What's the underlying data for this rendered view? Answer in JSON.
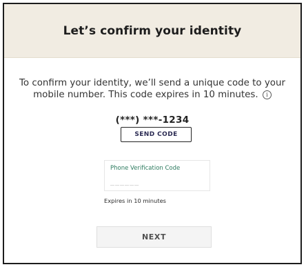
{
  "modal": {
    "title": "Let’s confirm your identity",
    "description_line1": "To confirm your identity, we’ll send a unique code to your",
    "description_line2": "mobile number. This code expires in 10 minutes.",
    "info_icon_glyph": "i",
    "info_icon": "info-circle-icon"
  },
  "phone": {
    "masked_number": "(***) ***-1234"
  },
  "send_code": {
    "label": "SEND CODE"
  },
  "verification_field": {
    "label": "Phone Verification Code",
    "value": "",
    "placeholder": "______"
  },
  "expiry_note": "Expires in 10 minutes",
  "next_button": {
    "label": "NEXT"
  },
  "colors": {
    "header_background": "#f1ece2",
    "field_label": "#2c7a5e",
    "send_code_text": "#2a2a52",
    "next_button_background": "#f4f4f4"
  }
}
